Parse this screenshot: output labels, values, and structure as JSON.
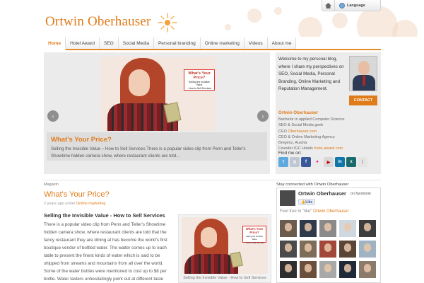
{
  "header": {
    "site_title": "Ortwin Oberhauser",
    "language_label": "Language"
  },
  "nav": {
    "items": [
      "Home",
      "Hotel Award",
      "SEO",
      "Social Media",
      "Personal branding",
      "Online marketing",
      "Videos",
      "About me"
    ],
    "active": "Home"
  },
  "slider": {
    "image_sign_title": "What's Your Price?",
    "image_sign_sub_1": "Selling the Invisible Value",
    "image_sign_sub_2": "- How to Sell Services",
    "caption_title": "What's Your Price?",
    "caption_text": "Selling the Invisible Value – How to Sell Services There is a popular video clip from Penn and Teller's Showtime hidden camera show, where restaurant clients are told..."
  },
  "profile": {
    "intro": "Welcome to my personal blog, where I share my perspectives on SEO, Social Media, Personal Branding, Online Marketing and Reputation Management.",
    "contact_label": "CONTACT",
    "name": "Ortwin Oberhauser",
    "line1": "Bachelor in applied Computer Science",
    "line2": "SEO & Social Media geek",
    "line3_prefix": "CEO ",
    "line3_link": "Oberhauser.com",
    "line4": "CEO & Online Marketing Agency",
    "line5": "Bregenz, Austria",
    "line6_prefix": "Founder IGC Hotels ",
    "line6_link": "hotel-award.com",
    "find_me": "Find me on:",
    "social_icons": [
      "twitter-icon",
      "google-plus-icon",
      "facebook-icon",
      "flickr-icon",
      "youtube-icon",
      "linkedin-icon",
      "xing-icon",
      "rss-icon"
    ]
  },
  "article": {
    "section": "Magazin",
    "title": "What's Your Price?",
    "meta_prefix": "2 years ago under ",
    "meta_link": "Online marketing",
    "heading": "Selling the Invisible Value - How to Sell Services",
    "body": "There is a popular video clip from Penn and Teller's Showtime hidden camera show, where restaurant clients are told that the fancy restaurant they are dining at has become the world's first boutique vendor of bottled water. The waiter comes up to each table to present the finest kinds of water which is said to be shipped from streams and mountains from all over the world. Some of the water bottles were mentioned to cost up to $8 per bottle. Water tasters unhesitatingly point out at different taste",
    "image_caption": "Selling the Invisible Value - How to Sell Services"
  },
  "facebook": {
    "title": "Stay connected with Ortwin Oberhauser",
    "name": "Ortwin Oberhauser",
    "on_facebook": "on facebook",
    "like_label": "Like",
    "feel_free_prefix": "Feel free to \"like\" ",
    "feel_free_link": "Ortwin Oberhauser"
  },
  "colors": {
    "accent": "#e07b1a",
    "panel": "#ececec",
    "facebook_blue": "#3b5998"
  }
}
